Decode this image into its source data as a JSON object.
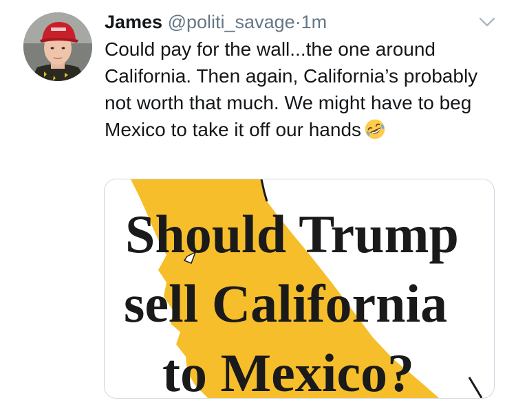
{
  "tweet": {
    "display_name": "James",
    "handle": "@politi_savage",
    "separator": "·",
    "timestamp": "1m",
    "menu_icon": "chevron-down-icon",
    "avatar_icon": "avatar",
    "text": "Could pay for the wall...the one around California. Then again, California’s probably not worth that much. We might have to beg Mexico to take it off our hands",
    "emoji": "rolling-on-floor-laughing-emoji"
  },
  "media": {
    "line1": "Should Trump",
    "line2": "sell California",
    "line3": "to Mexico?",
    "colors": {
      "map": "#f7be2b",
      "text": "#1a1a1a"
    }
  },
  "colors": {
    "primary_text": "#14171a",
    "secondary_text": "#657786",
    "border": "#ccd6dd"
  }
}
